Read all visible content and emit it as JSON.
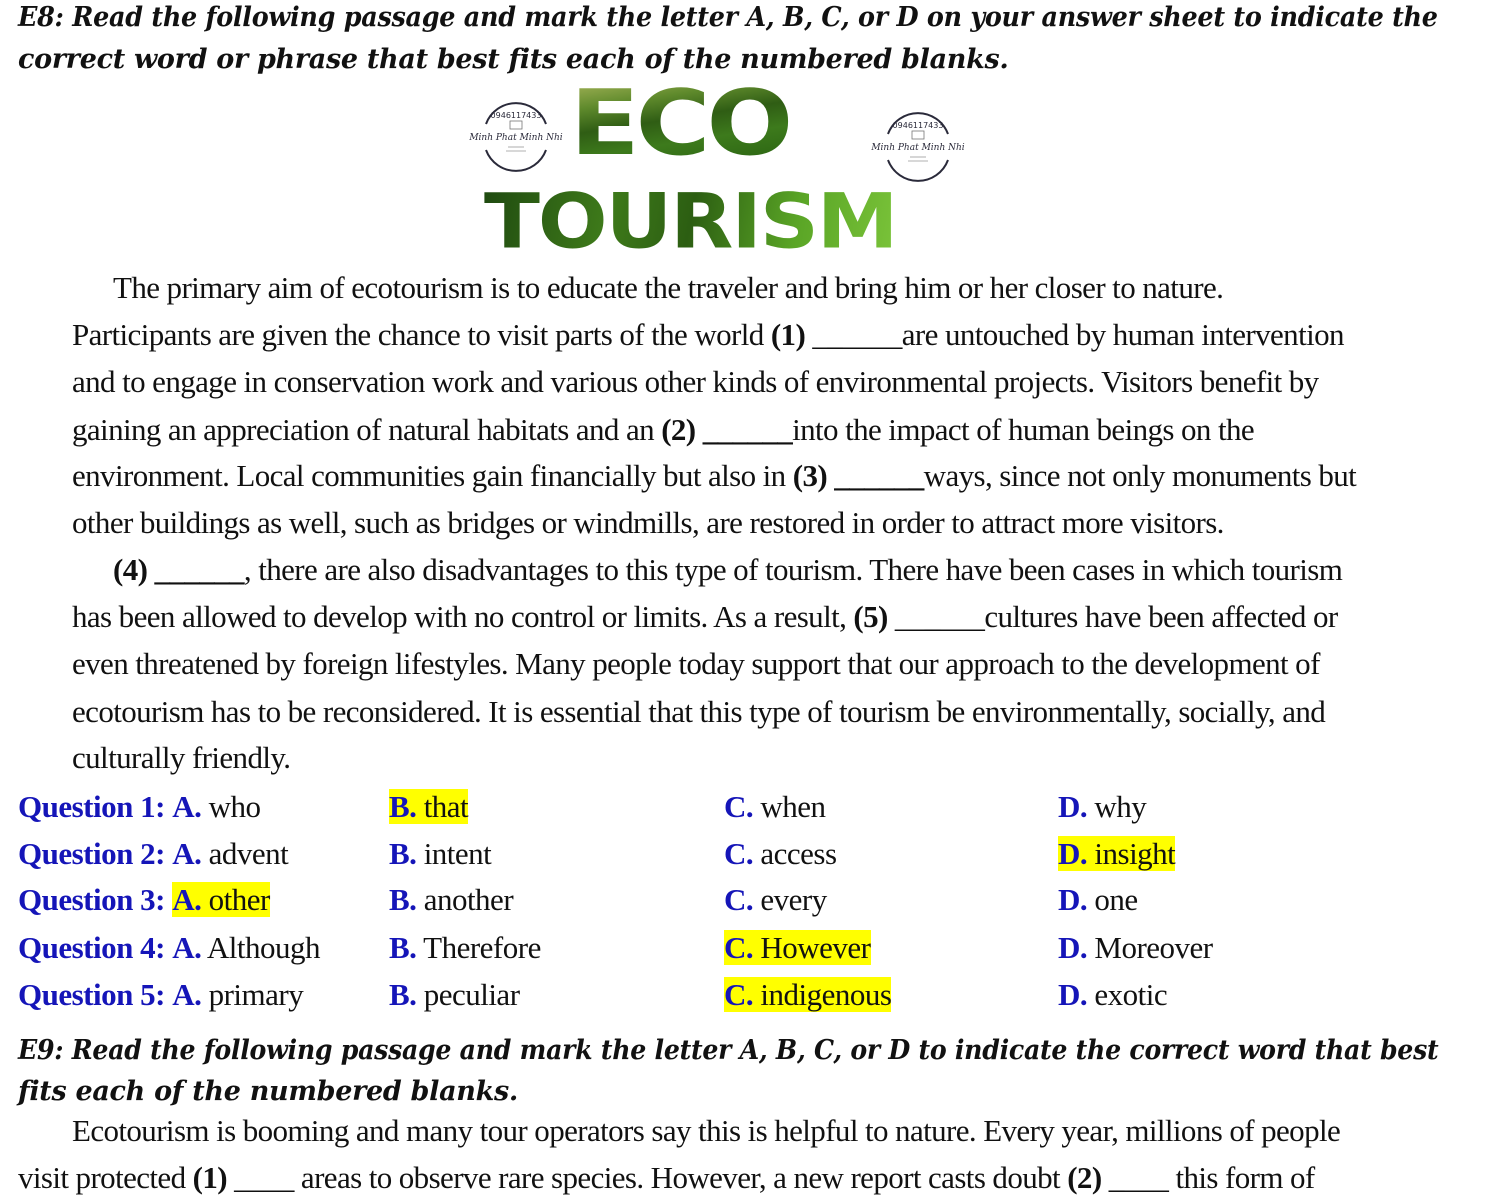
{
  "e8": {
    "instruction_line1": "E8: Read the following passage and mark the letter A, B, C, or D on your answer sheet to indicate the",
    "instruction_line2": "correct word or phrase that best fits each of the numbered blanks.",
    "banner": {
      "title_top": "ECO",
      "title_bottom": "TOURISM",
      "stamp_phone": "0946117433",
      "stamp_name": "Minh Phat Minh Nhi"
    },
    "passage": {
      "l1": "The primary aim of ecotourism is to educate the traveler and bring him or her closer to nature.",
      "l2a": "Participants are given the chance to visit parts of the world ",
      "l2n": "(1)",
      "l2b": " ______",
      "l2c": "are untouched by human intervention",
      "l3": "and to engage in conservation work and various other kinds of environmental projects. Visitors benefit by",
      "l4a": "gaining an appreciation of natural habitats and an ",
      "l4n": "(2)",
      "l4b": " ______",
      "l4c": "into the impact of human beings on the",
      "l5a": "environment. Local communities gain financially but also in ",
      "l5n": "(3)",
      "l5b": " ______",
      "l5c": "ways, since not only monuments but",
      "l6": "other buildings as well, such as bridges or windmills, are restored in order to attract more visitors.",
      "l7n": "(4)",
      "l7b": " ______",
      "l7c": ", there are also disadvantages to this type of tourism. There have been cases in which tourism",
      "l8a": "has been allowed to develop with no control or limits. As a result, ",
      "l8n": "(5)",
      "l8b": " ______",
      "l8c": "cultures have been affected or",
      "l9": "even threatened by foreign lifestyles. Many people today support that our approach to the development of",
      "l10": "ecotourism has to be reconsidered. It is essential that this type of tourism be environmentally, socially, and",
      "l11": "culturally friendly."
    },
    "questions": [
      {
        "label": "Question 1:",
        "options": [
          {
            "letter": "A.",
            "text": "who",
            "highlighted": false
          },
          {
            "letter": "B.",
            "text": "that",
            "highlighted": true
          },
          {
            "letter": "C.",
            "text": "when",
            "highlighted": false
          },
          {
            "letter": "D.",
            "text": "why",
            "highlighted": false
          }
        ]
      },
      {
        "label": "Question 2:",
        "options": [
          {
            "letter": "A.",
            "text": "advent",
            "highlighted": false
          },
          {
            "letter": "B.",
            "text": "intent",
            "highlighted": false
          },
          {
            "letter": "C.",
            "text": "access",
            "highlighted": false
          },
          {
            "letter": "D.",
            "text": "insight",
            "highlighted": true
          }
        ]
      },
      {
        "label": "Question 3:",
        "options": [
          {
            "letter": "A.",
            "text": "other",
            "highlighted": true
          },
          {
            "letter": "B.",
            "text": "another",
            "highlighted": false
          },
          {
            "letter": "C.",
            "text": "every",
            "highlighted": false
          },
          {
            "letter": "D.",
            "text": "one",
            "highlighted": false
          }
        ]
      },
      {
        "label": "Question 4:",
        "options": [
          {
            "letter": "A.",
            "text": "Although",
            "highlighted": false
          },
          {
            "letter": "B.",
            "text": "Therefore",
            "highlighted": false
          },
          {
            "letter": "C.",
            "text": "However",
            "highlighted": true
          },
          {
            "letter": "D.",
            "text": "Moreover",
            "highlighted": false
          }
        ]
      },
      {
        "label": "Question 5:",
        "options": [
          {
            "letter": "A.",
            "text": "primary",
            "highlighted": false
          },
          {
            "letter": "B.",
            "text": "peculiar",
            "highlighted": false
          },
          {
            "letter": "C.",
            "text": "indigenous",
            "highlighted": true
          },
          {
            "letter": "D.",
            "text": "exotic",
            "highlighted": false
          }
        ]
      }
    ]
  },
  "e9": {
    "instruction_line1": "E9: Read the following passage and mark the letter A, B, C, or D to indicate the correct word that best",
    "instruction_line2": "fits each of the numbered blanks.",
    "passage": {
      "l1": "Ecotourism is booming and many tour operators say this is helpful to nature. Every year, millions of people",
      "l2a": "visit protected ",
      "l2n": "(1)",
      "l2b": " ____ ",
      "l2c": "areas to observe rare species. However, a new report casts doubt ",
      "l2n2": "(2)",
      "l2d": " ____ ",
      "l2e": "this form of"
    }
  },
  "colors": {
    "question_blue": "#1515b8",
    "highlight": "#ffff00",
    "text": "#111111"
  }
}
